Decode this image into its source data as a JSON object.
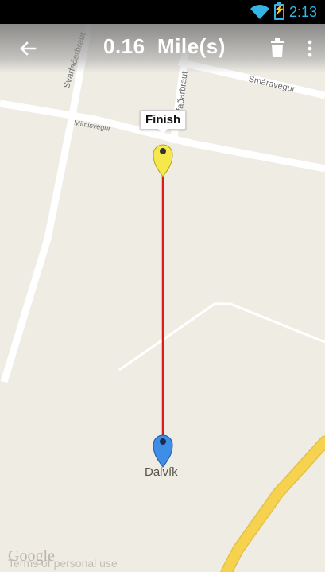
{
  "status": {
    "time": "2:13"
  },
  "actionbar": {
    "title": "0.16  Mile(s)"
  },
  "icons": {
    "back": "back-arrow-icon",
    "delete": "trash-icon",
    "overflow": "more-vert-icon",
    "wifi": "wifi-icon",
    "battery": "battery-charging-icon"
  },
  "map": {
    "finish_label": "Finish",
    "city_label": "Dalvík",
    "streets": [
      "Svarfaðarbraut",
      "Smáravegur",
      "Mímisvegur",
      "Svarfaðarbraut"
    ],
    "attribution": "Google",
    "terms": "Terms of personal use"
  },
  "colors": {
    "route": "#e01b1b",
    "finish_marker": "#f5e84a",
    "start_marker": "#3e8ee8",
    "status_accent": "#33b5e5",
    "highway": "#f6d24f"
  }
}
